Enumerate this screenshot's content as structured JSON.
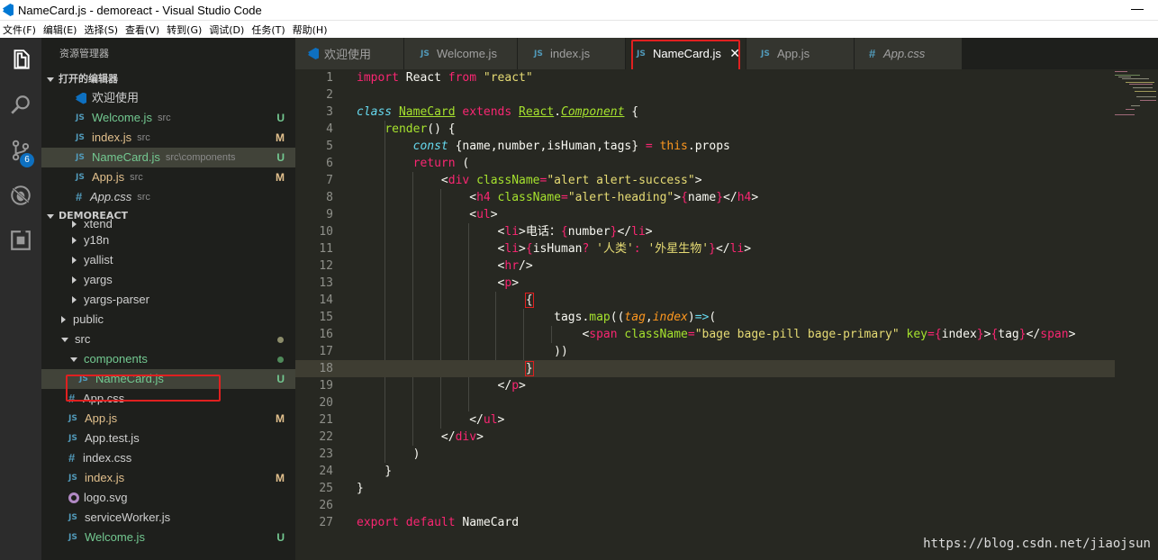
{
  "window": {
    "title": "NameCard.js - demoreact - Visual Studio Code"
  },
  "menu": [
    "文件(F)",
    "编辑(E)",
    "选择(S)",
    "查看(V)",
    "转到(G)",
    "调试(D)",
    "任务(T)",
    "帮助(H)"
  ],
  "activity": {
    "scm_badge": "6",
    "icons": [
      "files-icon",
      "search-icon",
      "source-control-icon",
      "debug-icon",
      "extensions-icon"
    ]
  },
  "sidebar": {
    "title": "资源管理器",
    "open_editors_label": "打开的编辑器",
    "open_editors": [
      {
        "name": "欢迎使用",
        "path": "",
        "status": "",
        "icon": "vscode"
      },
      {
        "name": "Welcome.js",
        "path": "src",
        "status": "U",
        "icon": "js"
      },
      {
        "name": "index.js",
        "path": "src",
        "status": "M",
        "icon": "js"
      },
      {
        "name": "NameCard.js",
        "path": "src\\components",
        "status": "U",
        "icon": "js"
      },
      {
        "name": "App.js",
        "path": "src",
        "status": "M",
        "icon": "js"
      },
      {
        "name": "App.css",
        "path": "src",
        "status": "",
        "icon": "css"
      }
    ],
    "project_label": "DEMOREACT",
    "tree": [
      {
        "name": "xtend",
        "status": ""
      },
      {
        "name": "y18n",
        "status": ""
      },
      {
        "name": "yallist",
        "status": ""
      },
      {
        "name": "yargs",
        "status": ""
      },
      {
        "name": "yargs-parser",
        "status": ""
      },
      {
        "name": "public",
        "status": ""
      },
      {
        "name": "src",
        "status": ""
      },
      {
        "name": "components",
        "status": ""
      },
      {
        "name": "NameCard.js",
        "status": "U"
      },
      {
        "name": "App.css",
        "status": ""
      },
      {
        "name": "App.js",
        "status": "M"
      },
      {
        "name": "App.test.js",
        "status": ""
      },
      {
        "name": "index.css",
        "status": ""
      },
      {
        "name": "index.js",
        "status": "M"
      },
      {
        "name": "logo.svg",
        "status": ""
      },
      {
        "name": "serviceWorker.js",
        "status": ""
      },
      {
        "name": "Welcome.js",
        "status": "U"
      }
    ]
  },
  "tabs": [
    "欢迎使用",
    "Welcome.js",
    "index.js",
    "NameCard.js",
    "App.js",
    "App.css"
  ],
  "tab_close": "✕",
  "tab_icons": {
    "js": "JS",
    "css": "#"
  },
  "editor": {
    "line_numbers": [
      "1",
      "2",
      "3",
      "4",
      "5",
      "6",
      "7",
      "8",
      "9",
      "10",
      "11",
      "12",
      "13",
      "14",
      "15",
      "16",
      "17",
      "18",
      "19",
      "20",
      "21",
      "22",
      "23",
      "24",
      "25",
      "26",
      "27"
    ]
  },
  "watermark": "https://blog.csdn.net/jiaojsun"
}
